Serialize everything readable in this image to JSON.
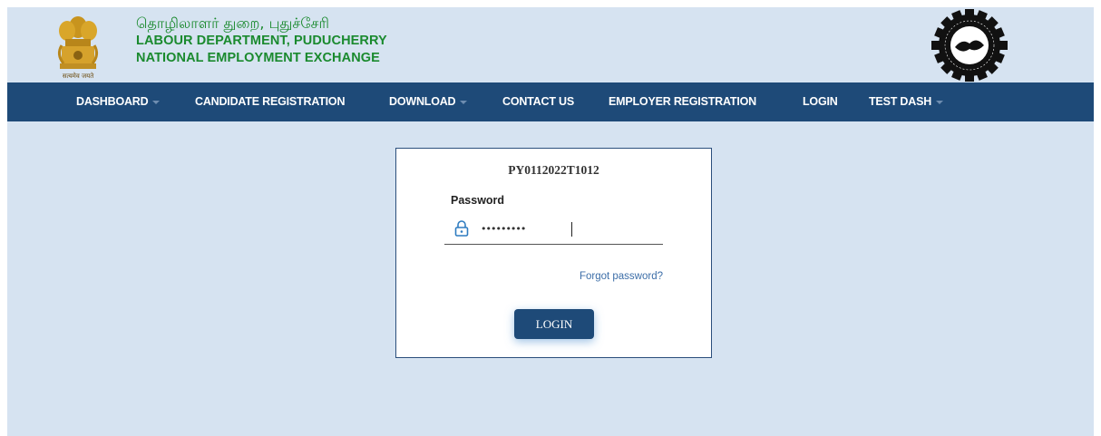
{
  "header": {
    "title_tamil": "தொழிலாளர் துறை, புதுச்சேரி",
    "title_line1": "LABOUR DEPARTMENT, PUDUCHERRY",
    "title_line2": "NATIONAL EMPLOYMENT EXCHANGE",
    "emblem_icon": "national-emblem-icon",
    "seal_icon": "employment-exchange-seal-icon",
    "seal_text": "FOR EMPLOYERS AND EMPLOYMENT SEEKERS · NATIONAL EMPLOYMENT SERVICE"
  },
  "nav": {
    "items": [
      {
        "label": "DASHBOARD",
        "dropdown": true
      },
      {
        "label": "CANDIDATE REGISTRATION",
        "dropdown": false
      },
      {
        "label": "DOWNLOAD",
        "dropdown": true
      },
      {
        "label": "CONTACT US",
        "dropdown": false
      },
      {
        "label": "EMPLOYER REGISTRATION",
        "dropdown": false
      },
      {
        "label": "LOGIN",
        "dropdown": false
      },
      {
        "label": "TEST DASH",
        "dropdown": true
      }
    ]
  },
  "login": {
    "registration_id": "PY0112022T1012",
    "password_label": "Password",
    "password_value": "•••••••••",
    "forgot_label": "Forgot password?",
    "login_label": "LOGIN",
    "lock_icon": "lock-icon"
  },
  "colors": {
    "navbar": "#1e4a78",
    "background": "#d6e3f1",
    "brand_green": "#1a8a2e",
    "link": "#3c6ea8"
  }
}
